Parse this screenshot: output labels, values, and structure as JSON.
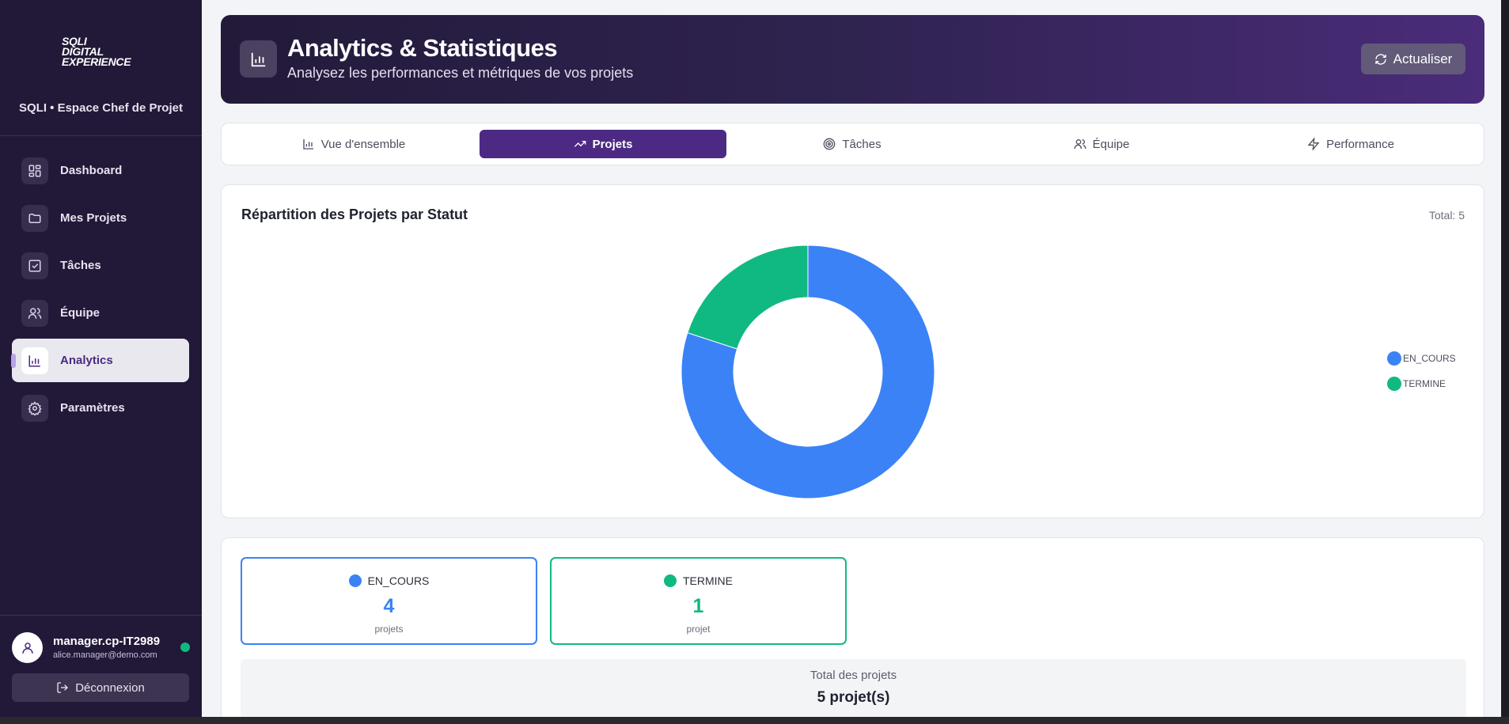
{
  "sidebar": {
    "logo_lines": [
      "SQLI",
      "DIGITAL",
      "EXPERIENCE"
    ],
    "space_title": "SQLI • Espace Chef de Projet",
    "items": [
      {
        "label": "Dashboard",
        "icon": "dashboard-icon"
      },
      {
        "label": "Mes Projets",
        "icon": "folder-icon"
      },
      {
        "label": "Tâches",
        "icon": "checkbox-icon"
      },
      {
        "label": "Équipe",
        "icon": "users-icon"
      },
      {
        "label": "Analytics",
        "icon": "bar-chart-icon",
        "active": true
      },
      {
        "label": "Paramètres",
        "icon": "gear-icon"
      }
    ],
    "user": {
      "name": "manager.cp-IT2989",
      "email": "alice.manager@demo.com",
      "status": "online"
    },
    "logout_label": "Déconnexion"
  },
  "header": {
    "title": "Analytics & Statistiques",
    "subtitle": "Analysez les performances et métriques de vos projets",
    "refresh_label": "Actualiser"
  },
  "tabs": [
    {
      "label": "Vue d'ensemble",
      "icon": "bar-chart-icon"
    },
    {
      "label": "Projets",
      "icon": "trending-up-icon",
      "active": true
    },
    {
      "label": "Tâches",
      "icon": "target-icon"
    },
    {
      "label": "Équipe",
      "icon": "users-icon"
    },
    {
      "label": "Performance",
      "icon": "zap-icon"
    }
  ],
  "chart_card": {
    "title": "Répartition des Projets par Statut",
    "total_label": "Total: 5"
  },
  "chart_data": {
    "type": "pie",
    "variant": "donut",
    "categories": [
      "EN_COURS",
      "TERMINE"
    ],
    "values": [
      4,
      1
    ],
    "colors": [
      "#3b82f6",
      "#10b981"
    ],
    "title": "Répartition des Projets par Statut",
    "legend": "right"
  },
  "stats": [
    {
      "status": "EN_COURS",
      "count": "4",
      "unit": "projets",
      "color": "#3b82f6"
    },
    {
      "status": "TERMINE",
      "count": "1",
      "unit": "projet",
      "color": "#10b981"
    }
  ],
  "total": {
    "label": "Total des projets",
    "value": "5 projet(s)"
  },
  "colors": {
    "sidebar_bg": "#221838",
    "accent": "#4c2a84",
    "blue": "#3b82f6",
    "green": "#10b981"
  }
}
